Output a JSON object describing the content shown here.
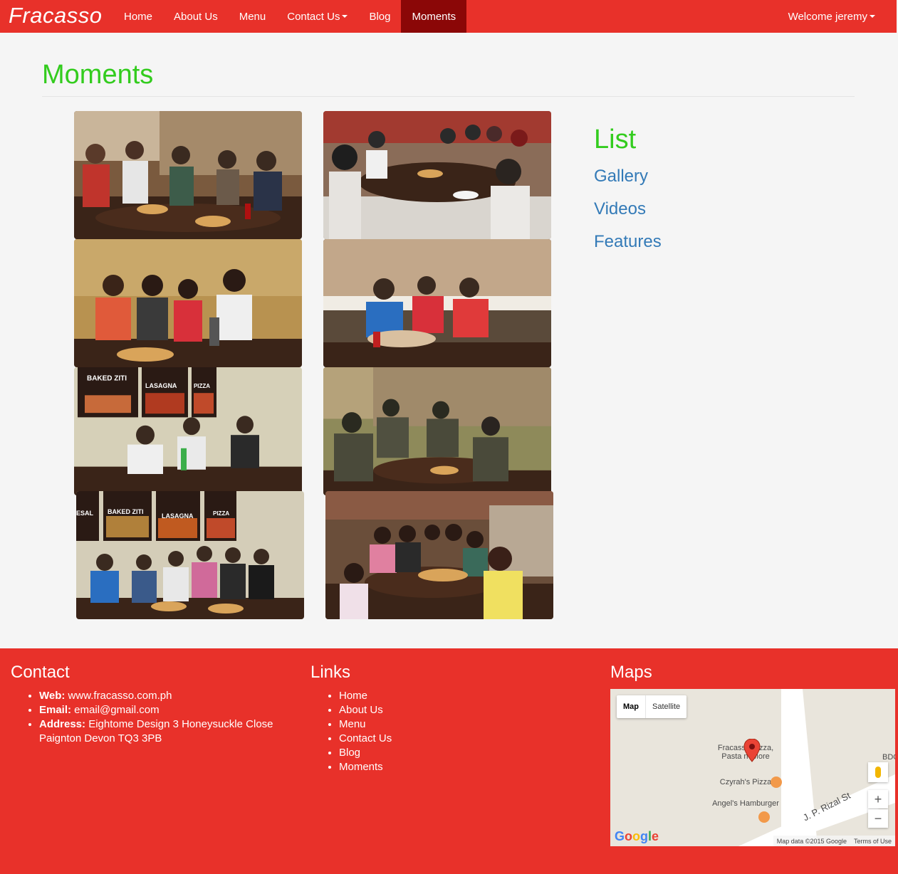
{
  "navbar": {
    "brand": "Fracasso",
    "items": [
      {
        "label": "Home"
      },
      {
        "label": "About Us"
      },
      {
        "label": "Menu"
      },
      {
        "label": "Contact Us"
      },
      {
        "label": "Blog"
      },
      {
        "label": "Moments"
      }
    ],
    "user_label": "Welcome jeremy"
  },
  "main": {
    "title": "Moments",
    "photos": [
      {
        "signs": []
      },
      {
        "signs": []
      },
      {
        "signs": []
      },
      {
        "signs": []
      },
      {
        "signs": [
          "BAKED ZITI",
          "LASAGNA",
          "PIZZA"
        ]
      },
      {
        "signs": []
      },
      {
        "signs": [
          "ESAL",
          "BAKED ZITI",
          "LASAGNA",
          "PIZZA"
        ]
      },
      {
        "signs": []
      }
    ]
  },
  "sidebar": {
    "title": "List",
    "links": [
      {
        "label": "Gallery"
      },
      {
        "label": "Videos"
      },
      {
        "label": "Features"
      }
    ]
  },
  "footer": {
    "contact": {
      "heading": "Contact",
      "web_key": "Web:",
      "web_val": " www.fracasso.com.ph",
      "email_key": "Email:",
      "email_val": " email@gmail.com",
      "address_key": "Address:",
      "address_val": " Eightome Design 3 Honeysuckle Close Paignton Devon TQ3 3PB"
    },
    "links": {
      "heading": "Links",
      "items": [
        "Home",
        "About Us",
        "Menu",
        "Contact Us",
        "Blog",
        "Moments"
      ]
    },
    "maps": {
      "heading": "Maps",
      "map_btn": "Map",
      "satellite_btn": "Satellite",
      "places": [
        "Fracasso Pizza, Pasta n' More",
        "Czyrah's Pizza",
        "Angel's Hamburger",
        "BDO"
      ],
      "street": "J. P. Rizal St",
      "zoom_in": "+",
      "zoom_out": "−",
      "map_data": "Map data ©2015 Google",
      "terms": "Terms of Use",
      "logo": "Google"
    }
  }
}
